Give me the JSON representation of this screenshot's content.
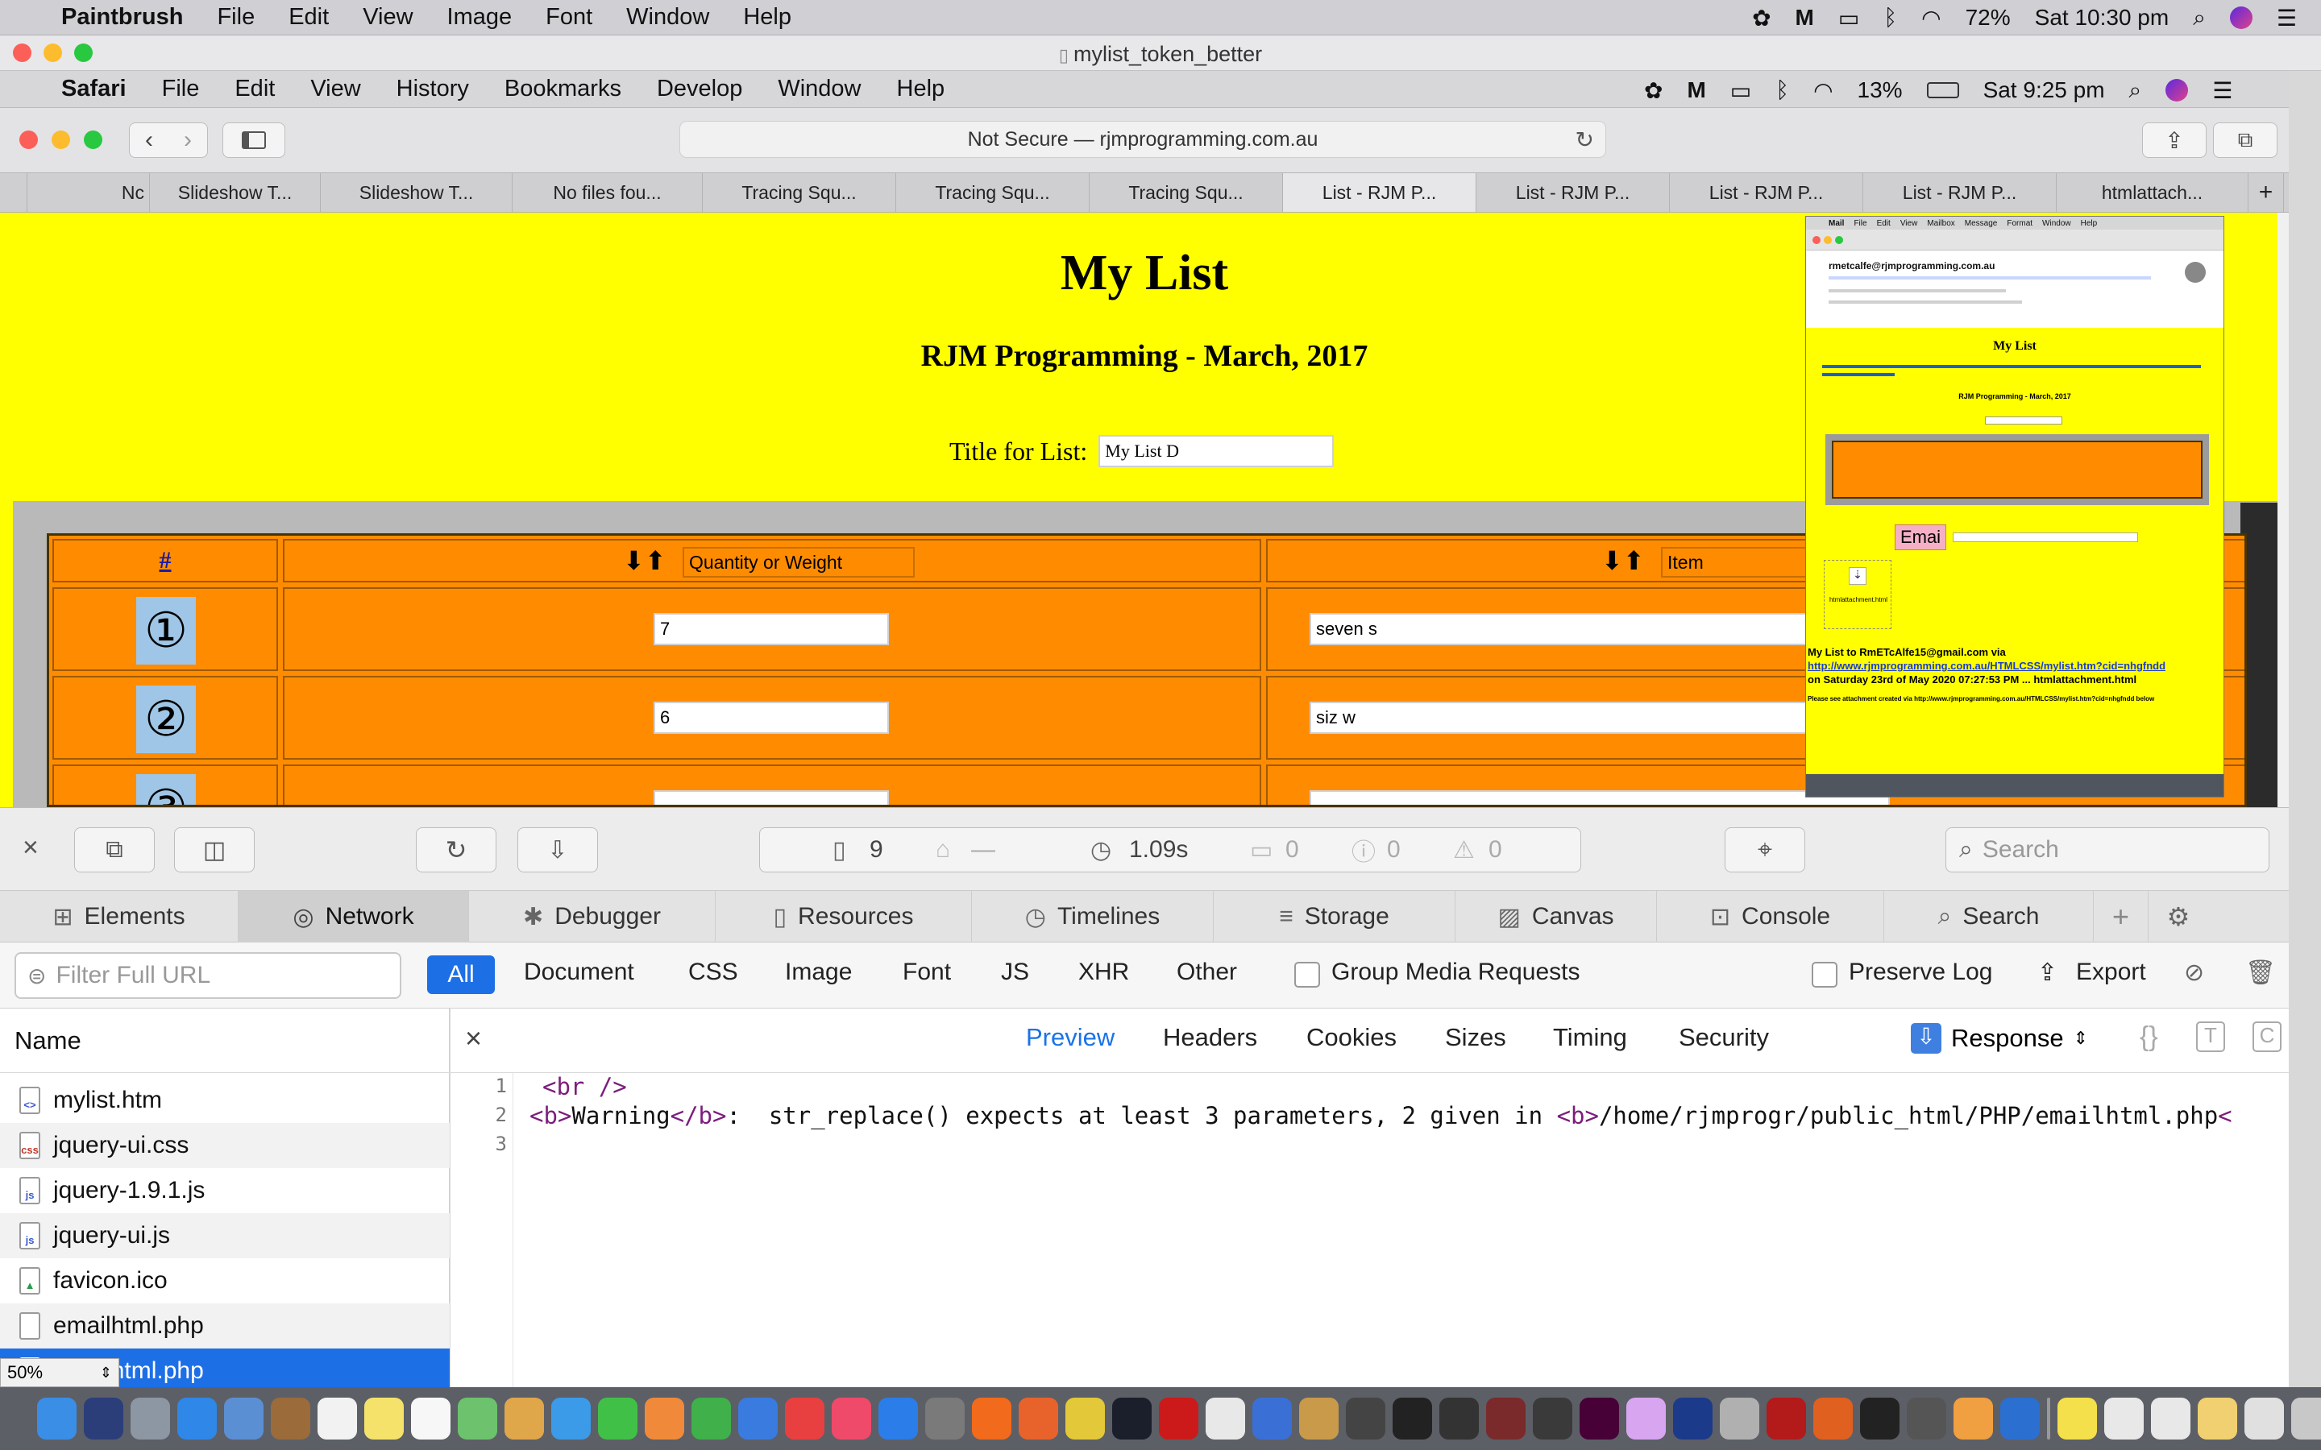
{
  "paintbrush": {
    "app_name": "Paintbrush",
    "menus": [
      "File",
      "Edit",
      "View",
      "Image",
      "Font",
      "Window",
      "Help"
    ],
    "battery": "72%",
    "clock": "Sat 10:30 pm",
    "window_title": "mylist_token_better"
  },
  "safari": {
    "app_name": "Safari",
    "menus": [
      "File",
      "Edit",
      "View",
      "History",
      "Bookmarks",
      "Develop",
      "Window",
      "Help"
    ],
    "battery": "13%",
    "clock": "Sat 9:25 pm",
    "address": "Not Secure — rjmprogramming.com.au",
    "tabs": [
      "Nc",
      "Slideshow T...",
      "Slideshow T...",
      "No files fou...",
      "Tracing Squ...",
      "Tracing Squ...",
      "Tracing Squ...",
      "List - RJM P...",
      "List - RJM P...",
      "List - RJM P...",
      "List - RJM P...",
      "htmlattach..."
    ],
    "active_tab": 7
  },
  "page": {
    "title": "My List",
    "subtitle": "RJM Programming - March, 2017",
    "title_label": "Title for List:",
    "title_value": "My List D",
    "columns": {
      "hash": "#",
      "sort_arrows": "⬇⬆",
      "quantity": "Quantity or Weight",
      "item": "Item"
    },
    "rows": [
      {
        "num": "①",
        "quantity": "7",
        "item": "seven s"
      },
      {
        "num": "②",
        "quantity": "6",
        "item": "siz w"
      },
      {
        "num": "③",
        "quantity": "",
        "item": ""
      }
    ]
  },
  "inset": {
    "mail_menus": [
      "Mail",
      "File",
      "Edit",
      "View",
      "Mailbox",
      "Message",
      "Format",
      "Window",
      "Help"
    ],
    "from": "rmetcalfe@rjmprogramming.com.au",
    "heading": "My List",
    "subheading": "RJM Programming - March, 2017",
    "email_button": "Emai",
    "attachment_name": "htmlattachment.html",
    "body_line1": "My List to RmETcAlfe15@gmail.com via",
    "body_link": "http://www.rjmprogramming.com.au/HTMLCSS/mylist.htm?cid=nhgfndd",
    "body_line2": "on Saturday 23rd of May 2020 07:27:53 PM ... htmlattachment.html",
    "body_line3": "Please see attachment created via http://www.rjmprogramming.com.au/HTMLCSS/mylist.htm?cid=nhgfndd below"
  },
  "devtools": {
    "resource_count": "9",
    "transfer": "—",
    "load_time": "1.09s",
    "console_count": "0",
    "error_count": "0",
    "warning_count": "0",
    "search_placeholder": "Search",
    "tabs": [
      "Elements",
      "Network",
      "Debugger",
      "Resources",
      "Timelines",
      "Storage",
      "Canvas",
      "Console",
      "Search"
    ],
    "active_tab": "Network",
    "filter_placeholder": "Filter Full URL",
    "types": [
      "All",
      "Document",
      "CSS",
      "Image",
      "Font",
      "JS",
      "XHR",
      "Other"
    ],
    "group_media": "Group Media Requests",
    "preserve_log": "Preserve Log",
    "export": "Export",
    "name_header": "Name",
    "files": [
      {
        "name": "mylist.htm",
        "kind": "html"
      },
      {
        "name": "jquery-ui.css",
        "kind": "css"
      },
      {
        "name": "jquery-1.9.1.js",
        "kind": "js"
      },
      {
        "name": "jquery-ui.js",
        "kind": "js"
      },
      {
        "name": "favicon.ico",
        "kind": "img"
      },
      {
        "name": "emailhtml.php",
        "kind": "doc"
      },
      {
        "name": "emailhtml.php",
        "kind": "doc"
      }
    ],
    "preview_tabs": [
      "Preview",
      "Headers",
      "Cookies",
      "Sizes",
      "Timing",
      "Security"
    ],
    "response_label": "Response",
    "code_lines": [
      {
        "n": "1",
        "parts": [
          "<br />"
        ]
      },
      {
        "n": "2",
        "parts": [
          "<b>",
          "Warning",
          "</b>",
          ":  str_replace() expects at least 3 parameters, 2 given in ",
          "<b>",
          "/home/rjmprogr/public_html/PHP/emailhtml.php",
          "<"
        ]
      },
      {
        "n": "3",
        "parts": []
      }
    ]
  },
  "paintbrush_zoom": "50%",
  "colors": {
    "page_bg": "#ffff00",
    "table_bg": "#ff8c00",
    "selection": "#1d6fe6",
    "accent": "#1a73e8"
  }
}
